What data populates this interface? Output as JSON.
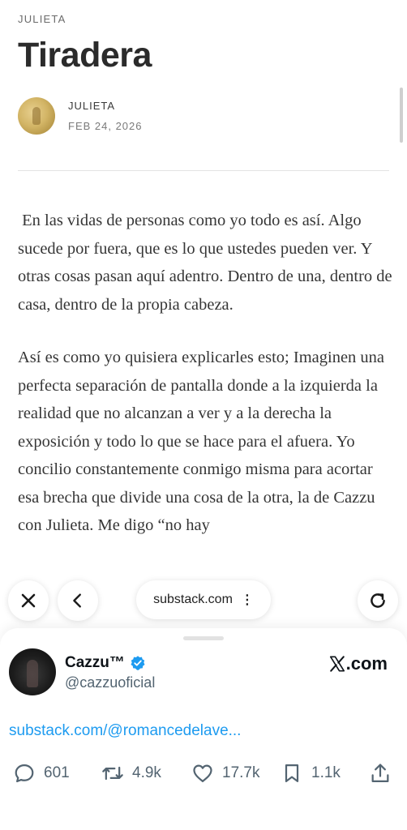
{
  "article": {
    "publication": "JULIETA",
    "title": "Tiradera",
    "author": "JULIETA",
    "date": "FEB 24, 2026",
    "paragraphs": [
      " En las vidas de personas como yo todo es así. Algo sucede por fuera, que es lo que ustedes pueden ver. Y otras cosas pasan aquí adentro. Dentro de una, dentro de casa, dentro de la propia cabeza.",
      "Así es como yo quisiera explicarles esto; Imaginen una perfecta separación de pantalla donde a la izquierda la realidad que no alcanzan a ver y a la derecha la exposición y todo lo que se hace para el afuera. Yo concilio constantemente conmigo misma para acortar esa brecha que divide una cosa de la otra, la de Cazzu con Julieta. Me digo “no hay"
    ]
  },
  "browser": {
    "url": "substack.com",
    "menu_icon": "more-vertical-icon",
    "close_icon": "close-icon",
    "back_icon": "chevron-left-icon",
    "reload_icon": "reload-icon"
  },
  "tweet": {
    "name": "Cazzu™",
    "handle": "@cazzuoficial",
    "site": ".com",
    "site_logo": "x-logo-icon",
    "link": "substack.com/@romancedelave...",
    "verified_color": "#1d9bf0",
    "stats": {
      "replies": "601",
      "retweets": "4.9k",
      "likes": "17.7k",
      "bookmarks": "1.1k"
    }
  }
}
